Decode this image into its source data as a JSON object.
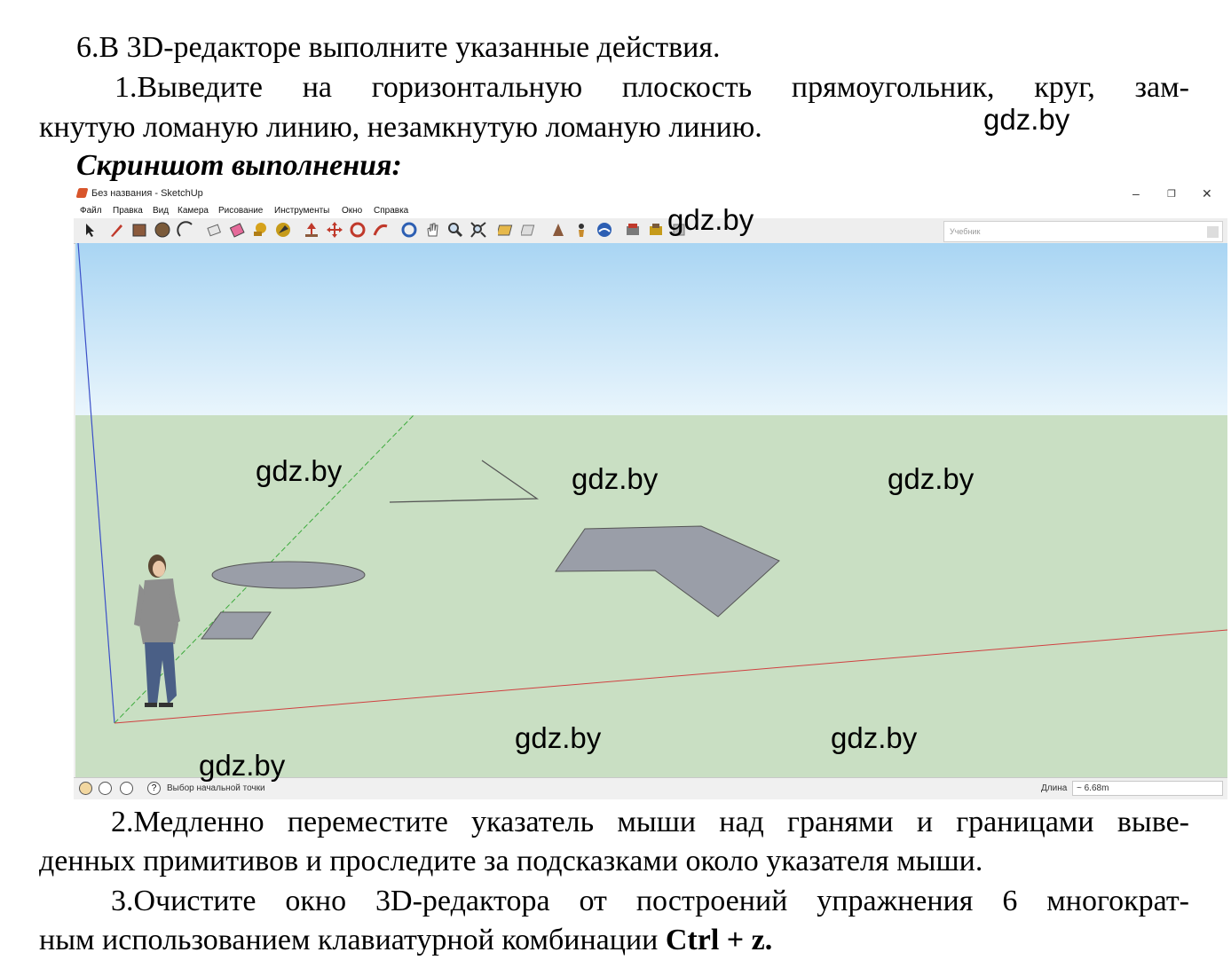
{
  "task": {
    "line1": "6.В 3D-редакторе выполните указанные действия.",
    "step1_line1": "1.Выведите на горизонтальную плоскость прямоугольник, круг, зам-",
    "step1_line2": "кнутую ломаную линию, незамкнутую ломаную линию.",
    "heading": "Скриншот выполнения:",
    "step2_line1": "2.Медленно переместите указатель мыши над гранями и границами выве-",
    "step2_line2": "денных примитивов и проследите за подсказками около указателя мыши.",
    "step3_line1": "3.Очистите окно 3D-редактора от построений упражнения 6 многократ-",
    "step3_line2_prefix": "ным использованием клавиатурной комбинации ",
    "step3_line2_bold": "Ctrl + z."
  },
  "watermark": "gdz.by",
  "sketchup": {
    "window_title": "Без названия - SketchUp",
    "controls": {
      "minimize": "–",
      "maximize": "❐",
      "close": "✕"
    },
    "menu": [
      "Файл",
      "Правка",
      "Вид",
      "Камера",
      "Рисование",
      "Инструменты",
      "Окно",
      "Справка"
    ],
    "toolbar_icons": [
      "select-icon",
      "pencil-icon",
      "rectangle-icon",
      "circle-icon",
      "arc-icon",
      "eraser-icon",
      "paint-bucket-icon",
      "tape-icon",
      "text-icon",
      "push-pull-icon",
      "move-icon",
      "rotate-icon",
      "follow-me-icon",
      "orbit-icon",
      "pan-icon",
      "zoom-icon",
      "zoom-extents-icon",
      "section-icon",
      "walk-icon",
      "look-icon",
      "position-camera-icon",
      "3d-warehouse-icon",
      "extension-icon",
      "layout-icon",
      "styles-icon"
    ],
    "search_placeholder": "Учебник",
    "status_hint": "Выбор начальной точки",
    "measure_label": "Длина",
    "measure_value": "~ 6.68m",
    "colors": {
      "sky_top": "#a9d5f3",
      "ground": "#c9dfc3",
      "face": "#9a9ea8",
      "axis_red": "#d04040",
      "axis_green": "#3caa3c",
      "axis_blue": "#3b4fc8"
    }
  }
}
